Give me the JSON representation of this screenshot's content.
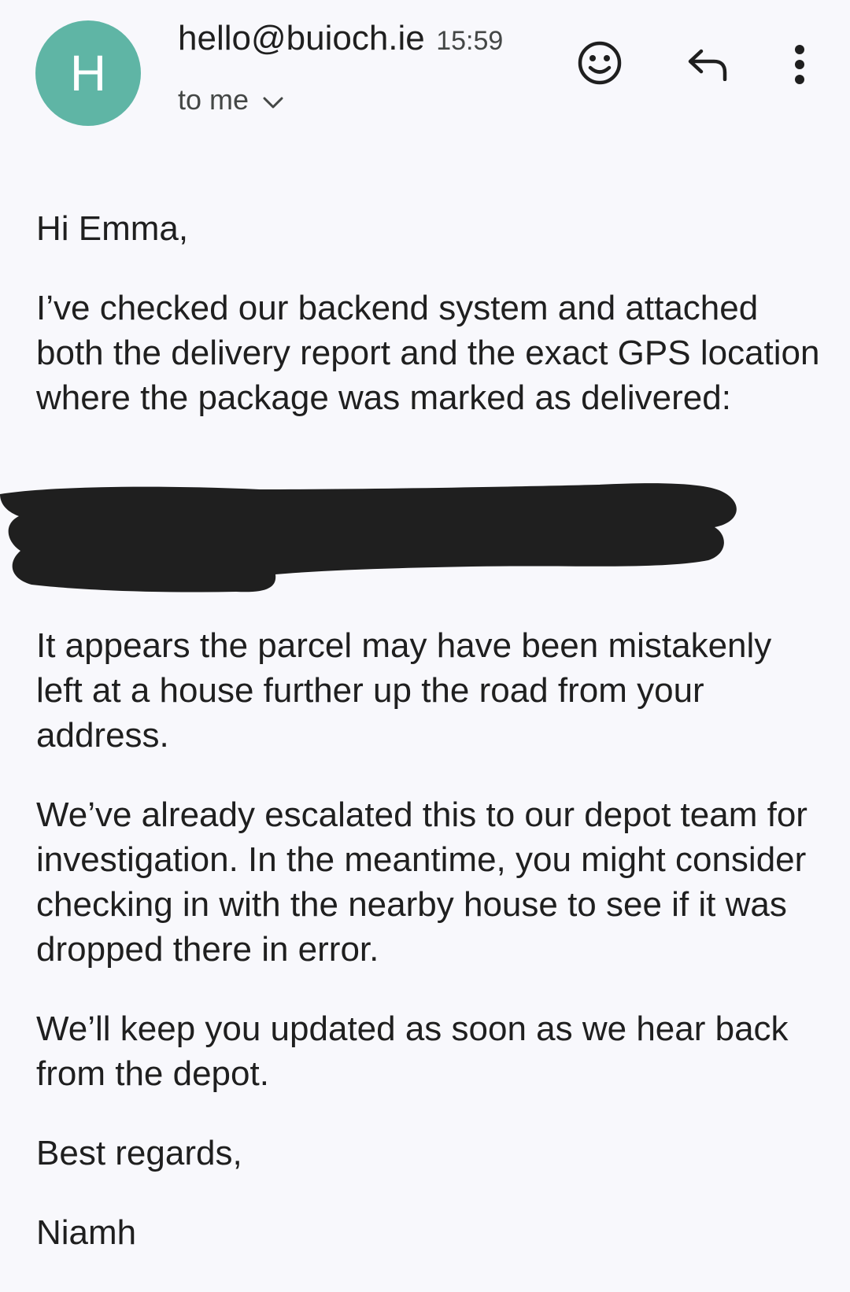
{
  "header": {
    "avatar_letter": "H",
    "avatar_color": "#5fb5a5",
    "sender": "hello@buioch.ie",
    "time": "15:59",
    "recipient": "to me",
    "icons": [
      "emoji-react-icon",
      "reply-icon",
      "more-vert-icon",
      "chevron-down-icon"
    ]
  },
  "email": {
    "greeting": "Hi Emma,",
    "intro": "I’ve checked our backend system and attached both the delivery report and the exact GPS location where the package was marked as delivered:",
    "para2": "It appears the parcel may have been mistakenly left at a house further up the road from your address.",
    "para3": "We’ve already escalated this to our depot team for investigation. In the meantime, you might consider checking in with the nearby house to see if it was dropped there in error.",
    "para4": "We’ll keep you updated as soon as we hear back from the depot.",
    "signoff": "Best regards,",
    "signature": "Niamh"
  }
}
